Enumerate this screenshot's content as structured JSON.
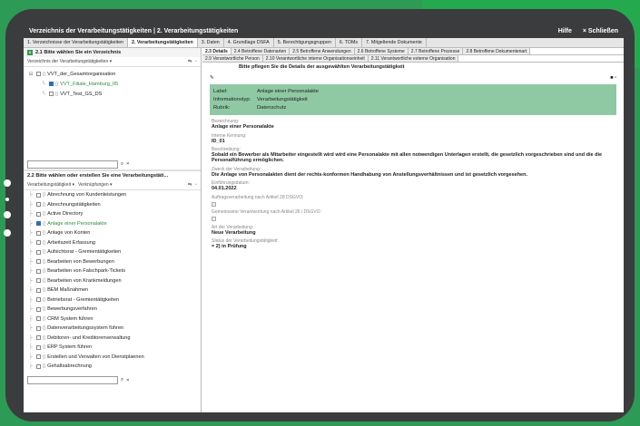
{
  "window": {
    "title": "Verzeichnis der Verarbeitungstätigkeiten | 2. Verarbeitungstätigkeiten",
    "help": "Hilfe",
    "close": "× Schließen"
  },
  "tabs": [
    "1. Verzeichnisse der Verarbeitungstätigkeiten",
    "2. Verarbeitungstätigkeiten",
    "3. Daten",
    "4. Grundlage DSFA",
    "5. Berechtigungsgruppen",
    "6. TOMs",
    "7. Mitgeltende Dokumente"
  ],
  "left": {
    "section1": "2.1 Bitte wählen Sie ein Verzeichnis",
    "toolbar1": "Verzeichnis der Verarbeitungstätigkeiten ▾",
    "tree": [
      "VVT_der_Gesamtorganisation",
      "VVT_Filiale_Hamburg_05",
      "VVT_Test_GS_DS"
    ],
    "section2": "2.2 Bitte wählen oder erstellen Sie eine Verarbeitungstäti...",
    "toolbar2a": "Verarbeitungstätigkeit ▾",
    "toolbar2b": "Verknüpfungen ▾",
    "items": [
      "Abrechnung von Kundenleistungen",
      "Abrechnungstätigkeiten",
      "Active Directory",
      "Anlage einer Personalakte",
      "Anlage von Konten",
      "Arbeitszeit Erfassung",
      "Aufsichtsrat - Gremientätigkeiten",
      "Bearbeiten von Bewerbungen",
      "Bearbeiten von Falschpark-Tickets",
      "Bearbeiten von Krankmeldungen",
      "BEM Maßnahmen",
      "Betriebsrat - Gremientätigkeiten",
      "Bewerbungsverfahren",
      "CRM System führen",
      "Datenverarbeitungssystem führen",
      "Debitoren- und Kreditorenverwaltung",
      "ERP System führen",
      "Erstellen und Verwalten von Dienstplaenen",
      "Gehaltsabrechnung"
    ]
  },
  "right": {
    "subtabs1": [
      "2.3 Details",
      "2.4 Betroffene Datenarten",
      "2.5 Betroffene Anwendungen",
      "2.6 Betroffene Systeme",
      "2.7 Betroffene Prozesse",
      "2.8 Betroffene Dokumentenart"
    ],
    "subtabs2": [
      "2.9 Verantwortliche Person",
      "2.10 Verantwortliche interne Organisationseinheit",
      "2.11 Verantwortliche externe Organisation"
    ],
    "hint": "Bitte pflegen Sie die Details der ausgewählten Verarbeitungstätigkeit",
    "card": [
      [
        "Label:",
        "Anlage einer Personalakte"
      ],
      [
        "Informationstyp:",
        "Verarbeitungstätigkeit"
      ],
      [
        "Rubrik:",
        "Datenschutz"
      ]
    ],
    "fields": [
      {
        "k": "Bezeichnung:",
        "v": "Anlage einer Personalakte"
      },
      {
        "k": "Interne Kennung:",
        "v": "ID_01"
      },
      {
        "k": "Beschreibung:",
        "v": "Sobald ein Bewerber als Mitarbeiter eingestellt wird wird eine Personalakte mit allen notwendigen Unterlagen erstellt, die gesetzlich vorgeschrieben sind und die die Personalführung ermöglichen."
      },
      {
        "k": "Zweck der Verarbeitung:",
        "v": "Die Anlage von Personalakten dient der rechts-konformen Handhabung von Anstellungsverhältnissen und ist gesetzlich vorgesehen."
      },
      {
        "k": "Einführungsdatum:",
        "v": "04.01.2022"
      },
      {
        "k": "Auftragsverarbeitung nach Artikel 28 DSGVO:",
        "v": ""
      },
      {
        "k": "Gemeinsame Verantwortung nach Artikel 26 i DSGVO:",
        "v": ""
      },
      {
        "k": "Art der Verarbeitung:",
        "v": "Neue Verarbeitung"
      },
      {
        "k": "Status der Verarbeitungstätigkeit:",
        "v": "= 2) in Prüfung"
      }
    ]
  }
}
